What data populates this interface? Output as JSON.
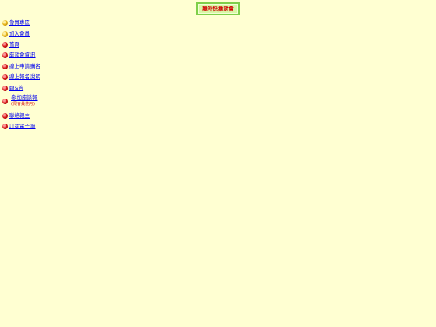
{
  "header": {
    "title": "離外快推談會"
  },
  "nav": {
    "items": [
      {
        "label": "會員專區",
        "icon": "gold-ball-icon"
      },
      {
        "label": "加入會員",
        "icon": "gold-ball-icon"
      },
      {
        "label": "首頁",
        "icon": "red-ball-icon"
      },
      {
        "label": "座談會資訊",
        "icon": "red-ball-icon"
      },
      {
        "label": "線上申請購名",
        "icon": "red-ball-icon"
      },
      {
        "label": "線上報名說明",
        "icon": "red-ball-icon"
      },
      {
        "label": "問&答",
        "icon": "red-ball-icon"
      },
      {
        "label": "參加座談報",
        "icon": "red-ball-icon",
        "note": "(限會員使用)"
      },
      {
        "label": "聯絡親主",
        "icon": "red-ball-icon"
      },
      {
        "label": "訂閱電子報",
        "icon": "red-ball-icon"
      }
    ]
  },
  "colors": {
    "background": "#ffffd2",
    "link": "#0000ee",
    "title_text": "#d20000",
    "title_bg": "#d9f7a6",
    "title_border": "#7fcf4a"
  }
}
